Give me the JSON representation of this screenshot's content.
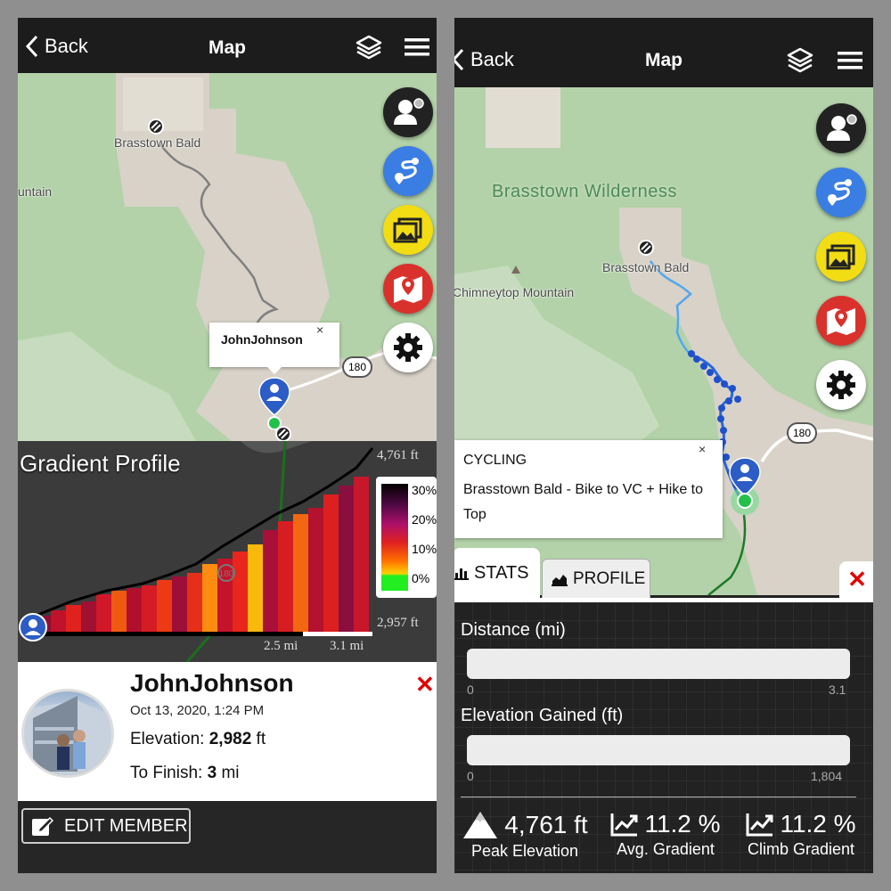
{
  "colors": {
    "accent_blue": "#2f6fe0",
    "route_blue": "#3b8de6",
    "close_red": "#e00000",
    "dark_bar": "#1c1c1c",
    "map_green": "#b3d2a9",
    "fab_profile": "#222222",
    "fab_routes": "#3a7de3",
    "fab_photos": "#f2dc13",
    "fab_maps": "#d9322c",
    "fab_settings": "#ffffff"
  },
  "left": {
    "navbar": {
      "back_label": "Back",
      "title": "Map",
      "layers_icon": "layers-icon",
      "menu_icon": "hamburger-menu-icon"
    },
    "map": {
      "labels": {
        "brasstown_bald": "Brasstown Bald",
        "mountain_fragment": "untain",
        "road_shield": "180"
      },
      "popup": {
        "name": "JohnJohnson",
        "close": "×"
      }
    },
    "fabs": [
      "profile-icon",
      "routes-icon",
      "photos-icon",
      "maps-icon",
      "settings-icon"
    ],
    "gradient_profile": {
      "title": "Gradient Profile",
      "top_elevation": "4,761 ft",
      "bottom_elevation": "2,957 ft",
      "distance_marker_1": "2.5 mi",
      "distance_marker_2": "3.1 mi",
      "legend": [
        "30%",
        "20%",
        "10%",
        "0%"
      ],
      "road_shield": "180"
    },
    "member": {
      "name": "JohnJohnson",
      "date": "Oct 13, 2020, 1:24 PM",
      "elevation_label": "Elevation: ",
      "elevation_value": "2,982",
      "elevation_unit": " ft",
      "finish_label": "To Finish: ",
      "finish_value": "3",
      "finish_unit": " mi",
      "close": "✕"
    },
    "edit_member_label": "EDIT MEMBER"
  },
  "right": {
    "navbar": {
      "back_label": "Back",
      "title": "Map",
      "layers_icon": "layers-icon",
      "menu_icon": "hamburger-menu-icon"
    },
    "map": {
      "labels": {
        "wilderness": "Brasstown Wilderness",
        "brasstown_bald": "Brasstown Bald",
        "chimneytop": "Chimneytop Mountain",
        "road_shield": "180"
      },
      "popup": {
        "category": "CYCLING",
        "title": "Brasstown Bald - Bike to VC + Hike to Top",
        "close": "×"
      }
    },
    "tabs": {
      "stats": "STATS",
      "profile": "PROFILE",
      "close": "✕"
    },
    "stats": {
      "distance": {
        "label": "Distance (mi)",
        "min": "0",
        "max": "3.1",
        "progress": 0
      },
      "elevation": {
        "label": "Elevation Gained (ft)",
        "min": "0",
        "max": "1,804",
        "progress": 0
      }
    },
    "summary": [
      {
        "value": "4,761 ft",
        "caption": "Peak Elevation",
        "icon": "mountain-icon"
      },
      {
        "value": "11.2 %",
        "caption": "Avg. Gradient",
        "icon": "trend-chart-icon"
      },
      {
        "value": "11.2 %",
        "caption": "Climb Gradient",
        "icon": "trend-chart-icon"
      }
    ]
  }
}
